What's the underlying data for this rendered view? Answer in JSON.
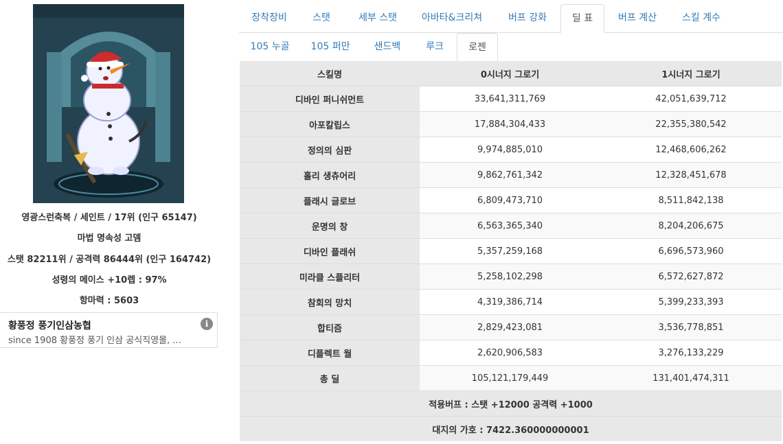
{
  "character": {
    "line1": "영광스런축복 / 세인트 / 17위 (인구 65147)",
    "line2": "마법 명속성 고뎀",
    "line3": "스탯 82211위 / 공격력 86444위 (인구 164742)",
    "line4": "성령의 메이스 +10렙 : 97%",
    "line5": "항마력 : 5603"
  },
  "ad": {
    "title": "황풍정 풍기인삼농협",
    "description": "since 1908 황풍정 풍기 인삼 공식직영몰, ...",
    "info_icon": "i"
  },
  "tabs_main": [
    "장착장비",
    "스탯",
    "세부 스탯",
    "아바타&크리쳐",
    "버프 강화",
    "딜 표",
    "버프 계산",
    "스킬 계수"
  ],
  "tabs_main_active": "딜 표",
  "tabs_sub": [
    "105 누골",
    "105 퍼만",
    "샌드백",
    "루크",
    "로젠"
  ],
  "tabs_sub_active": "로젠",
  "table": {
    "headers": [
      "스킬명",
      "0시너지 그로기",
      "1시너지 그로기"
    ],
    "rows": [
      {
        "name": "디바인 퍼니쉬먼트",
        "v0": "33,641,311,769",
        "v1": "42,051,639,712"
      },
      {
        "name": "아포칼립스",
        "v0": "17,884,304,433",
        "v1": "22,355,380,542"
      },
      {
        "name": "정의의 심판",
        "v0": "9,974,885,010",
        "v1": "12,468,606,262"
      },
      {
        "name": "홀리 생츄어리",
        "v0": "9,862,761,342",
        "v1": "12,328,451,678"
      },
      {
        "name": "플래시 글로브",
        "v0": "6,809,473,710",
        "v1": "8,511,842,138"
      },
      {
        "name": "운명의 창",
        "v0": "6,563,365,340",
        "v1": "8,204,206,675"
      },
      {
        "name": "디바인 플래쉬",
        "v0": "5,357,259,168",
        "v1": "6,696,573,960"
      },
      {
        "name": "미라클 스플리터",
        "v0": "5,258,102,298",
        "v1": "6,572,627,872"
      },
      {
        "name": "참회의 망치",
        "v0": "4,319,386,714",
        "v1": "5,399,233,393"
      },
      {
        "name": "합티즘",
        "v0": "2,829,423,081",
        "v1": "3,536,778,851"
      },
      {
        "name": "디플렉트 월",
        "v0": "2,620,906,583",
        "v1": "3,276,133,229"
      },
      {
        "name": "총 딜",
        "v0": "105,121,179,449",
        "v1": "131,401,474,311"
      }
    ],
    "footer1": "적용버프 : 스탯 +12000 공격력 +1000",
    "footer2": "대지의 가호 : 7422.360000000001"
  },
  "colors": {
    "link": "#337ab7",
    "header_bg": "#e8e8e8",
    "border": "#dddddd"
  }
}
